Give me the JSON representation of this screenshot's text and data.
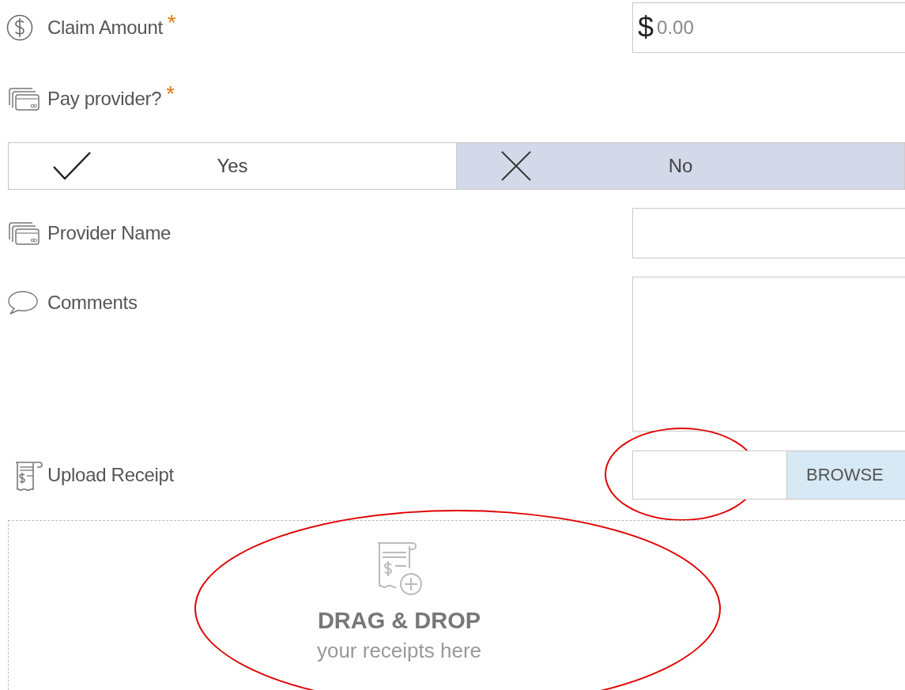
{
  "fields": [
    {
      "kind": "amount",
      "label": "Claim Amount",
      "required_mark": "*",
      "currency": "$",
      "placeholder": "0.00"
    },
    {
      "kind": "choice",
      "label": "Pay provider?",
      "required_mark": "*",
      "options": [
        {
          "label": "Yes",
          "kind": "check",
          "selected": false
        },
        {
          "label": "No",
          "kind": "cross",
          "selected": true
        }
      ]
    },
    {
      "kind": "text",
      "label": "Provider Name"
    },
    {
      "kind": "textarea",
      "label": "Comments"
    },
    {
      "kind": "file",
      "label": "Upload Receipt",
      "button": "BROWSE",
      "annotated": true
    }
  ],
  "dropzone": {
    "title": "DRAG & DROP",
    "subtitle": "your receipts here",
    "annotated": true
  }
}
